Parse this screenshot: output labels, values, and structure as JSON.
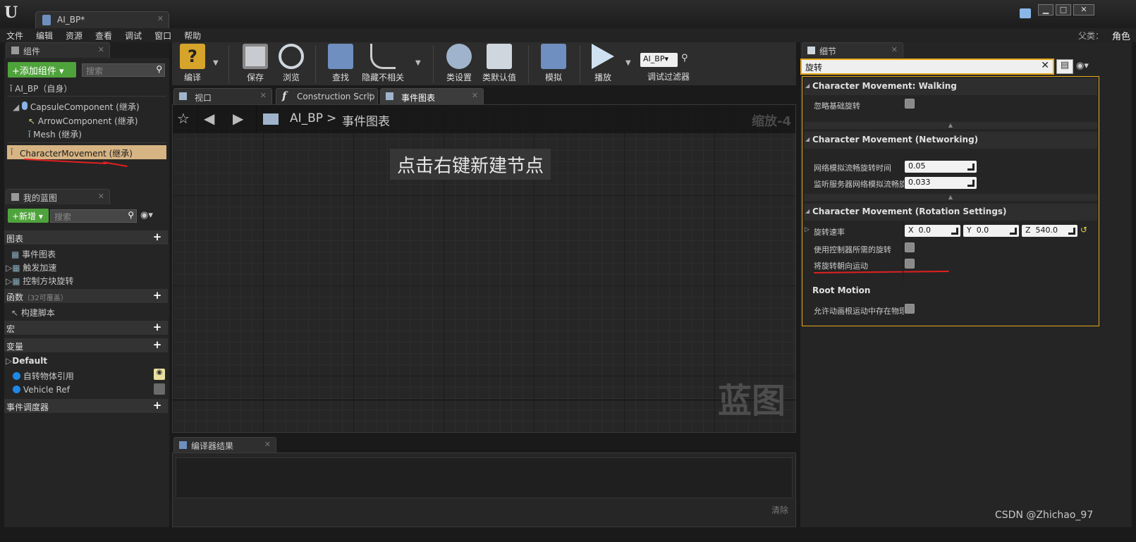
{
  "window": {
    "doc_tab": "AI_BP*"
  },
  "menu": [
    "文件",
    "编辑",
    "资源",
    "查看",
    "调试",
    "窗口",
    "帮助"
  ],
  "parent": {
    "label": "父类：",
    "value": "角色"
  },
  "components": {
    "tab": "组件",
    "add_button": "+添加组件 ▾",
    "search_placeholder": "搜索",
    "self": "AI_BP（自身）",
    "items": [
      "CapsuleComponent (继承)",
      "ArrowComponent (继承)",
      "Mesh (继承)",
      "CharacterMovement (继承)"
    ]
  },
  "my_blueprint": {
    "tab": "我的蓝图",
    "new_button": "+新增 ▾",
    "search_placeholder": "搜索",
    "graphs_header": "图表",
    "graphs": [
      "事件图表",
      "触发加速",
      "控制方块旋转"
    ],
    "functions_header": "函数",
    "functions_note": "（32可覆盖）",
    "functions": [
      "构建脚本"
    ],
    "macros_header": "宏",
    "variables_header": "变量",
    "default_group": "Default",
    "variables": [
      "自转物体引用",
      "Vehicle Ref"
    ],
    "dispatchers_header": "事件调度器"
  },
  "toolbar": {
    "buttons": [
      "编译",
      "保存",
      "浏览",
      "查找",
      "隐藏不相关",
      "类设置",
      "类默认值",
      "模拟",
      "播放"
    ],
    "debug_select": "AI_BP▾",
    "debug_label": "调试过滤器"
  },
  "graph_tabs": [
    "视口",
    "Construction Scrip",
    "事件图表"
  ],
  "graph": {
    "breadcrumb_root": "AI_BP",
    "breadcrumb_sep": ">",
    "breadcrumb_leaf": "事件图表",
    "zoom": "缩放-4",
    "hint": "点击右键新建节点",
    "watermark": "蓝图"
  },
  "compiler": {
    "tab": "编译器结果",
    "clear": "清除"
  },
  "details": {
    "tab": "细节",
    "search_value": "旋转",
    "cat1": "Character Movement: Walking",
    "p_ignore_base_rotation": "忽略基础旋转",
    "cat2": "Character Movement (Networking)",
    "p_net_smooth_time": "网络模拟流畅旋转时间",
    "v_net_smooth_time": "0.05",
    "p_listen_smooth": "监听服务器网络模拟流畅旋",
    "v_listen_smooth": "0.033",
    "cat3": "Character Movement (Rotation Settings)",
    "p_rotation_rate": "旋转速率",
    "rot_x_label": "X",
    "rot_x": "0.0",
    "rot_y_label": "Y",
    "rot_y": "0.0",
    "rot_z_label": "Z",
    "rot_z": "540.0",
    "p_use_controller_rotation": "使用控制器所需的旋转",
    "p_orient_to_movement": "将旋转朝向运动",
    "cat4": "Root Motion",
    "p_root_motion_physics": "允许动画根运动中存在物理"
  },
  "watermark_text": "CSDN @Zhichao_97",
  "colors": {
    "accent_orange": "#e6a817",
    "selection": "#d7b483",
    "green_button": "#4fa33c",
    "annotation_red": "#e02020"
  }
}
